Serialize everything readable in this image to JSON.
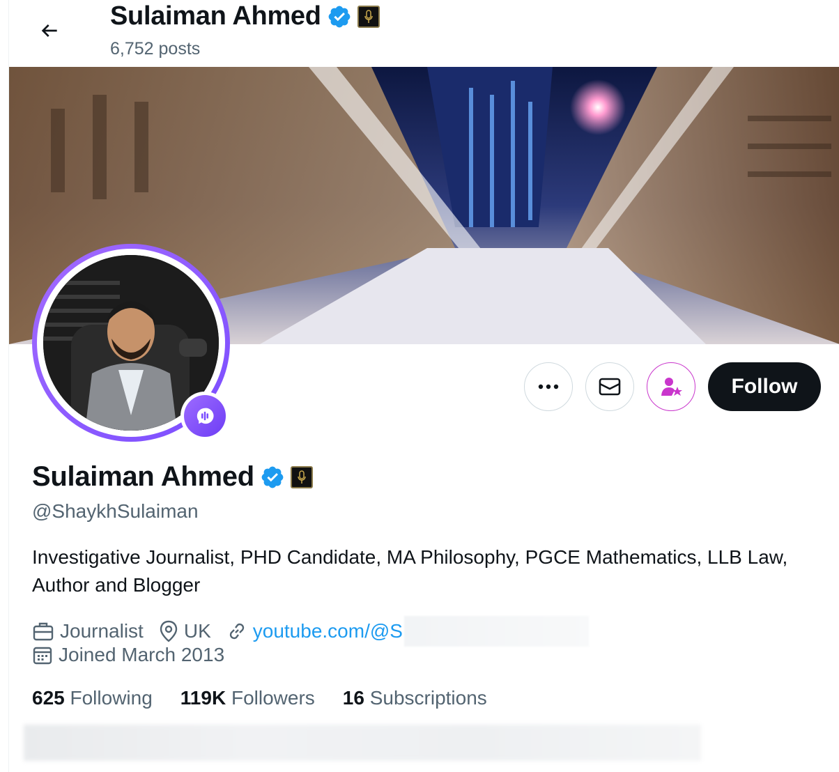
{
  "header": {
    "display_name": "Sulaiman Ahmed",
    "posts_count": "6,752 posts"
  },
  "profile": {
    "display_name": "Sulaiman Ahmed",
    "handle": "@ShaykhSulaiman",
    "bio": "Investigative Journalist, PHD Candidate, MA Philosophy, PGCE Mathematics, LLB Law, Author and Blogger",
    "profession": "Journalist",
    "location": "UK",
    "website": "youtube.com/@S",
    "joined": "Joined March 2013"
  },
  "actions": {
    "follow_label": "Follow",
    "more_icon": "more-icon",
    "message_icon": "mail-icon",
    "subscribe_icon": "subscribe-icon"
  },
  "stats": {
    "following_count": "625",
    "following_label": "Following",
    "followers_count": "119K",
    "followers_label": "Followers",
    "subscriptions_count": "16",
    "subscriptions_label": "Subscriptions"
  },
  "colors": {
    "accent": "#1d9bf0",
    "subscribe": "#c936cc",
    "spaces": "#7a4dff",
    "text_secondary": "#536471"
  }
}
